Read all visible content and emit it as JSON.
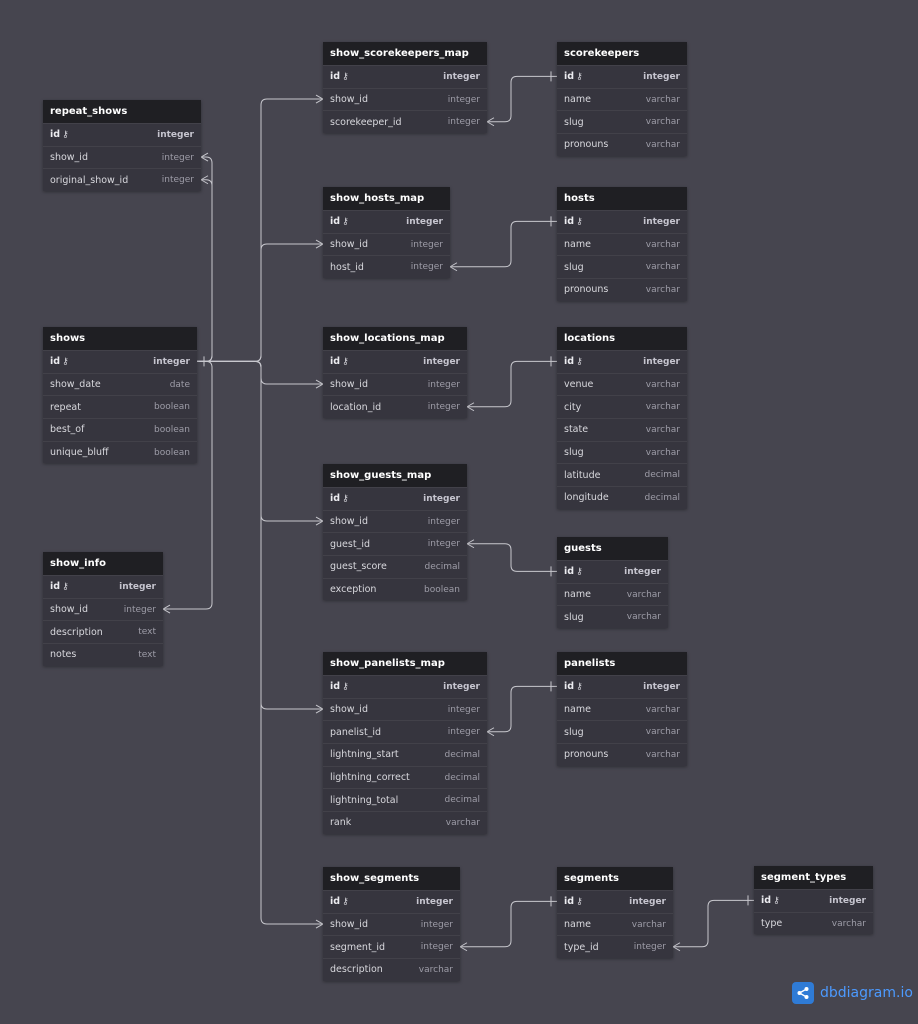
{
  "tables": [
    {
      "name": "repeat_shows",
      "columns": [
        {
          "name": "id",
          "type": "integer",
          "pk": true
        },
        {
          "name": "show_id",
          "type": "integer"
        },
        {
          "name": "original_show_id",
          "type": "integer"
        }
      ]
    },
    {
      "name": "shows",
      "columns": [
        {
          "name": "id",
          "type": "integer",
          "pk": true
        },
        {
          "name": "show_date",
          "type": "date"
        },
        {
          "name": "repeat",
          "type": "boolean"
        },
        {
          "name": "best_of",
          "type": "boolean"
        },
        {
          "name": "unique_bluff",
          "type": "boolean"
        }
      ]
    },
    {
      "name": "show_info",
      "columns": [
        {
          "name": "id",
          "type": "integer",
          "pk": true
        },
        {
          "name": "show_id",
          "type": "integer"
        },
        {
          "name": "description",
          "type": "text"
        },
        {
          "name": "notes",
          "type": "text"
        }
      ]
    },
    {
      "name": "show_scorekeepers_map",
      "columns": [
        {
          "name": "id",
          "type": "integer",
          "pk": true
        },
        {
          "name": "show_id",
          "type": "integer"
        },
        {
          "name": "scorekeeper_id",
          "type": "integer"
        }
      ]
    },
    {
      "name": "show_hosts_map",
      "columns": [
        {
          "name": "id",
          "type": "integer",
          "pk": true
        },
        {
          "name": "show_id",
          "type": "integer"
        },
        {
          "name": "host_id",
          "type": "integer"
        }
      ]
    },
    {
      "name": "show_locations_map",
      "columns": [
        {
          "name": "id",
          "type": "integer",
          "pk": true
        },
        {
          "name": "show_id",
          "type": "integer"
        },
        {
          "name": "location_id",
          "type": "integer"
        }
      ]
    },
    {
      "name": "show_guests_map",
      "columns": [
        {
          "name": "id",
          "type": "integer",
          "pk": true
        },
        {
          "name": "show_id",
          "type": "integer"
        },
        {
          "name": "guest_id",
          "type": "integer"
        },
        {
          "name": "guest_score",
          "type": "decimal"
        },
        {
          "name": "exception",
          "type": "boolean"
        }
      ]
    },
    {
      "name": "show_panelists_map",
      "columns": [
        {
          "name": "id",
          "type": "integer",
          "pk": true
        },
        {
          "name": "show_id",
          "type": "integer"
        },
        {
          "name": "panelist_id",
          "type": "integer"
        },
        {
          "name": "lightning_start",
          "type": "decimal"
        },
        {
          "name": "lightning_correct",
          "type": "decimal"
        },
        {
          "name": "lightning_total",
          "type": "decimal"
        },
        {
          "name": "rank",
          "type": "varchar"
        }
      ]
    },
    {
      "name": "show_segments",
      "columns": [
        {
          "name": "id",
          "type": "integer",
          "pk": true
        },
        {
          "name": "show_id",
          "type": "integer"
        },
        {
          "name": "segment_id",
          "type": "integer"
        },
        {
          "name": "description",
          "type": "varchar"
        }
      ]
    },
    {
      "name": "scorekeepers",
      "columns": [
        {
          "name": "id",
          "type": "integer",
          "pk": true
        },
        {
          "name": "name",
          "type": "varchar"
        },
        {
          "name": "slug",
          "type": "varchar"
        },
        {
          "name": "pronouns",
          "type": "varchar"
        }
      ]
    },
    {
      "name": "hosts",
      "columns": [
        {
          "name": "id",
          "type": "integer",
          "pk": true
        },
        {
          "name": "name",
          "type": "varchar"
        },
        {
          "name": "slug",
          "type": "varchar"
        },
        {
          "name": "pronouns",
          "type": "varchar"
        }
      ]
    },
    {
      "name": "locations",
      "columns": [
        {
          "name": "id",
          "type": "integer",
          "pk": true
        },
        {
          "name": "venue",
          "type": "varchar"
        },
        {
          "name": "city",
          "type": "varchar"
        },
        {
          "name": "state",
          "type": "varchar"
        },
        {
          "name": "slug",
          "type": "varchar"
        },
        {
          "name": "latitude",
          "type": "decimal"
        },
        {
          "name": "longitude",
          "type": "decimal"
        }
      ]
    },
    {
      "name": "guests",
      "columns": [
        {
          "name": "id",
          "type": "integer",
          "pk": true
        },
        {
          "name": "name",
          "type": "varchar"
        },
        {
          "name": "slug",
          "type": "varchar"
        }
      ]
    },
    {
      "name": "panelists",
      "columns": [
        {
          "name": "id",
          "type": "integer",
          "pk": true
        },
        {
          "name": "name",
          "type": "varchar"
        },
        {
          "name": "slug",
          "type": "varchar"
        },
        {
          "name": "pronouns",
          "type": "varchar"
        }
      ]
    },
    {
      "name": "segments",
      "columns": [
        {
          "name": "id",
          "type": "integer",
          "pk": true
        },
        {
          "name": "name",
          "type": "varchar"
        },
        {
          "name": "type_id",
          "type": "integer"
        }
      ]
    },
    {
      "name": "segment_types",
      "columns": [
        {
          "name": "id",
          "type": "integer",
          "pk": true
        },
        {
          "name": "type",
          "type": "varchar"
        }
      ]
    }
  ],
  "relationships": [
    {
      "from": "repeat_shows.show_id",
      "to": "shows.id"
    },
    {
      "from": "repeat_shows.original_show_id",
      "to": "shows.id"
    },
    {
      "from": "show_info.show_id",
      "to": "shows.id"
    },
    {
      "from": "show_scorekeepers_map.show_id",
      "to": "shows.id"
    },
    {
      "from": "show_hosts_map.show_id",
      "to": "shows.id"
    },
    {
      "from": "show_locations_map.show_id",
      "to": "shows.id"
    },
    {
      "from": "show_guests_map.show_id",
      "to": "shows.id"
    },
    {
      "from": "show_panelists_map.show_id",
      "to": "shows.id"
    },
    {
      "from": "show_segments.show_id",
      "to": "shows.id"
    },
    {
      "from": "show_scorekeepers_map.scorekeeper_id",
      "to": "scorekeepers.id"
    },
    {
      "from": "show_hosts_map.host_id",
      "to": "hosts.id"
    },
    {
      "from": "show_locations_map.location_id",
      "to": "locations.id"
    },
    {
      "from": "show_guests_map.guest_id",
      "to": "guests.id"
    },
    {
      "from": "show_panelists_map.panelist_id",
      "to": "panelists.id"
    },
    {
      "from": "show_segments.segment_id",
      "to": "segments.id"
    },
    {
      "from": "segments.type_id",
      "to": "segment_types.id"
    }
  ],
  "icons": {
    "primary_key": "key-icon",
    "brand": "share-icon"
  },
  "colors": {
    "background": "#46454f",
    "table_header": "#1f1f23",
    "table_body": "#36353e",
    "connector": "#c8c8ce",
    "brand": "#4c9aff"
  },
  "brand": {
    "text": "dbdiagram.io"
  }
}
